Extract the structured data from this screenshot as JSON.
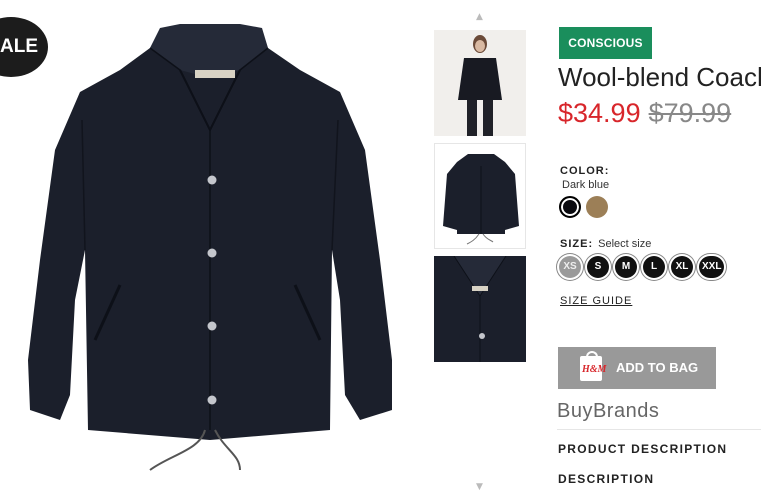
{
  "badge": {
    "sale": "SALE"
  },
  "thumbnails": {
    "up_arrow": "▲",
    "down_arrow": "▼",
    "items": [
      "model-wearing-jacket",
      "jacket-front",
      "jacket-collar-detail"
    ]
  },
  "product": {
    "tag": "CONSCIOUS",
    "title": "Wool-blend Coach Jacket",
    "price_sale": "$34.99",
    "price_original": "$79.99",
    "color_label": "COLOR:",
    "color_value": "Dark blue",
    "swatches": [
      {
        "name": "Dark blue",
        "hex": "#0a0a0f",
        "selected": true
      },
      {
        "name": "Beige",
        "hex": "#9c7f57",
        "selected": false
      }
    ],
    "size_label": "SIZE:",
    "size_hint": "Select size",
    "sizes": [
      {
        "label": "XS",
        "available": false
      },
      {
        "label": "S",
        "available": true
      },
      {
        "label": "M",
        "available": true
      },
      {
        "label": "L",
        "available": true
      },
      {
        "label": "XL",
        "available": true
      },
      {
        "label": "XXL",
        "available": true
      }
    ],
    "size_guide": "SIZE GUIDE",
    "add_to_bag": "ADD TO BAG",
    "bag_logo": "H&M",
    "brand": "BuyBrands",
    "sections": [
      "PRODUCT DESCRIPTION",
      "DESCRIPTION"
    ]
  },
  "colors": {
    "conscious_green": "#1a8e5c",
    "sale_red": "#d8262b",
    "button_gray": "#999999",
    "jacket_navy": "#1b1f2b"
  }
}
